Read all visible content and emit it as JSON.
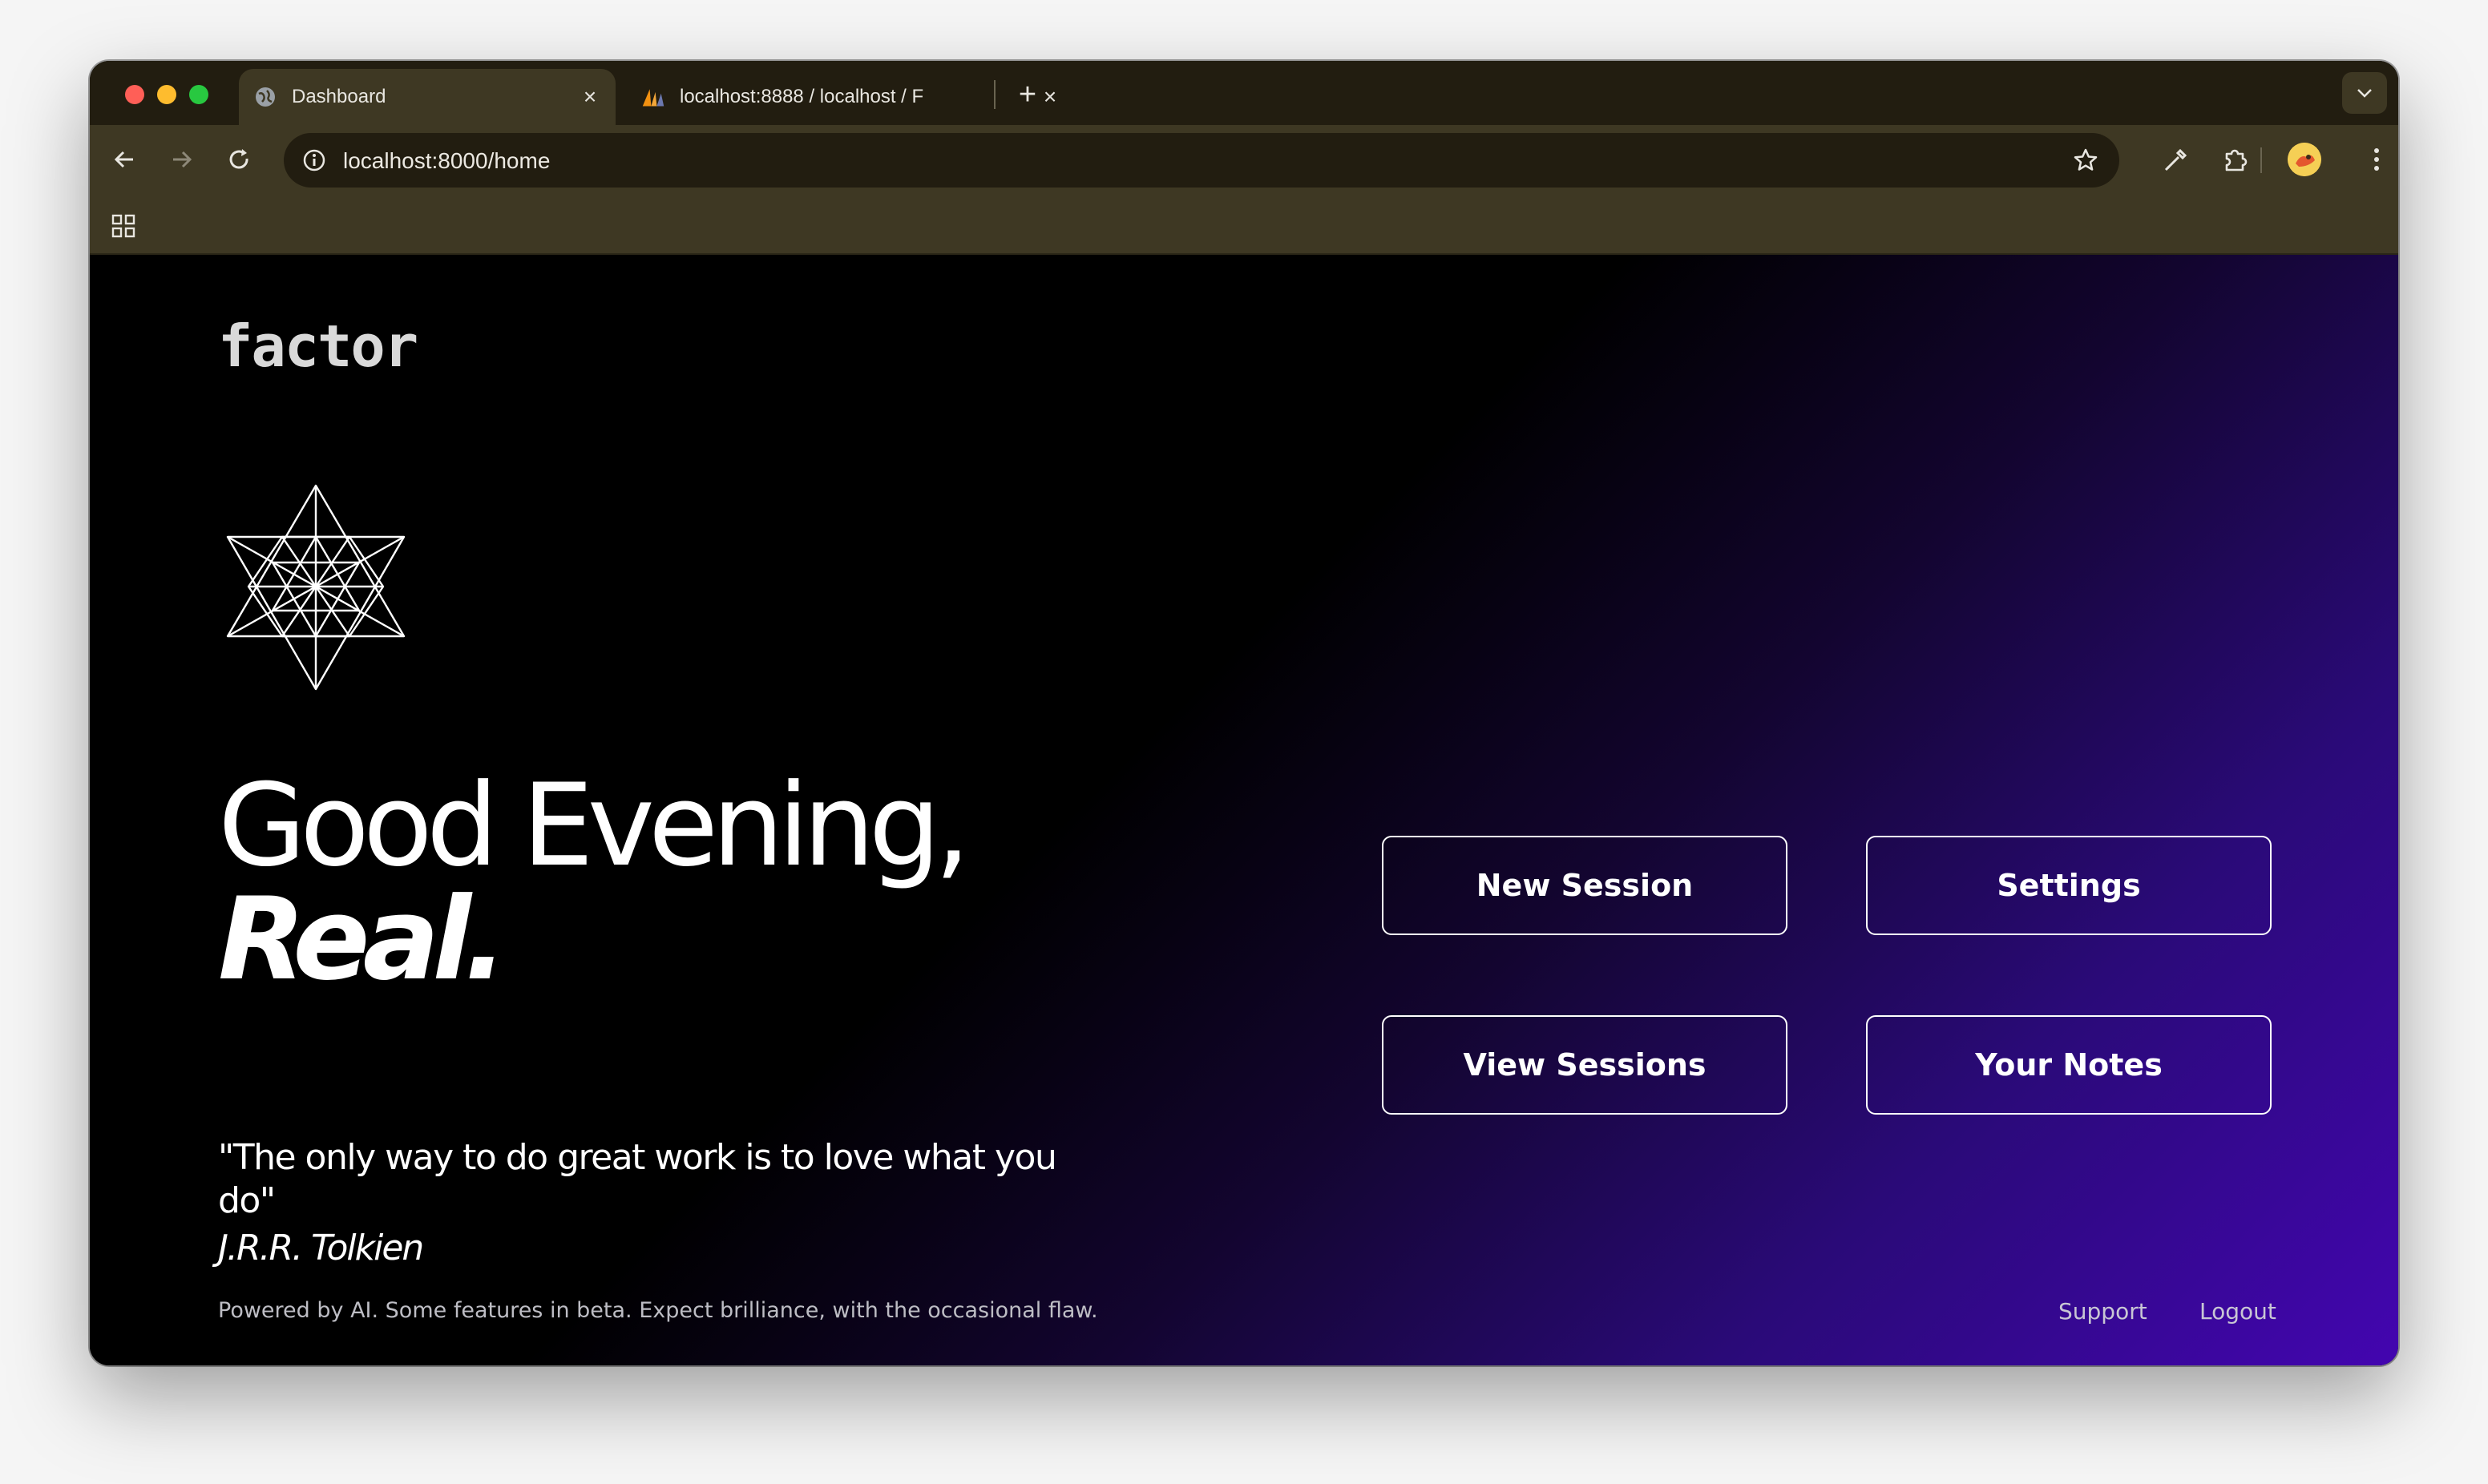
{
  "browser": {
    "tabs": [
      {
        "title": "Dashboard",
        "active": true,
        "favicon": "globe-icon"
      },
      {
        "title": "localhost:8888 / localhost / F",
        "active": false,
        "favicon": "phpmyadmin-sail-icon"
      }
    ],
    "address_bar": {
      "url": "localhost:8000/home"
    }
  },
  "page": {
    "logo_text": "factor",
    "greeting": {
      "line1": "Good Evening,",
      "name": "Real."
    },
    "quote": {
      "text": "\"The only way to do great work is to love what you do\"",
      "author": "J.R.R. Tolkien"
    },
    "buttons": {
      "new_session": "New Session",
      "settings": "Settings",
      "view_sessions": "View Sessions",
      "your_notes": "Your Notes"
    },
    "footer": {
      "disclaimer": "Powered by AI. Some features in beta. Expect brilliance, with the occasional flaw.",
      "support": "Support",
      "logout": "Logout"
    }
  },
  "colors": {
    "gradient_end": "#4305b0",
    "browser_chrome": "#3e3823"
  }
}
